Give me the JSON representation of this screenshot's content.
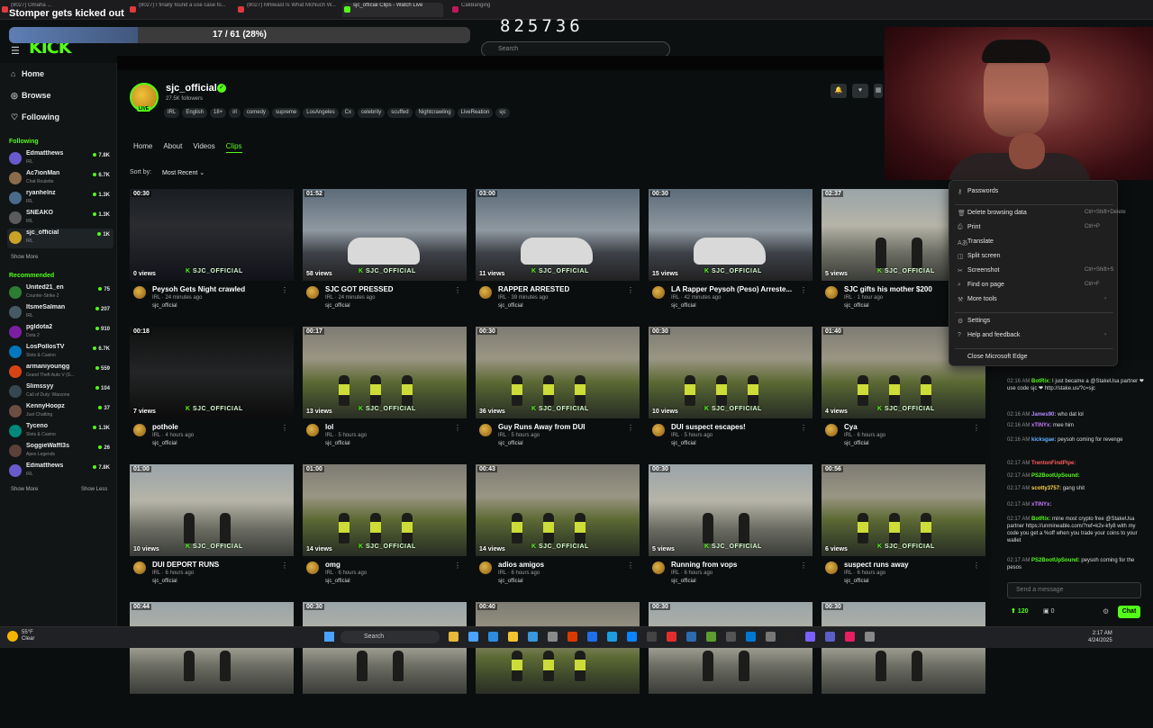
{
  "browser": {
    "tabs": [
      {
        "label": "(8027) Omaha ..."
      },
      {
        "label": "(8027) I finally found a use case fo..."
      },
      {
        "label": "(8027) MrBeast Is What McNuch W..."
      },
      {
        "label": "sjc_official Clips - Watch Live"
      },
      {
        "label": "CaliBanging"
      }
    ]
  },
  "overlay": {
    "stream_title": "Stomper gets kicked out",
    "progress_text": "17 / 61 (28%)",
    "progress_fraction": 0.28,
    "counter": "825736"
  },
  "site": {
    "logo": "KICK",
    "search_placeholder": "Search"
  },
  "sidebar": {
    "nav": [
      {
        "label": "Home",
        "icon": "home-icon"
      },
      {
        "label": "Browse",
        "icon": "compass-icon"
      },
      {
        "label": "Following",
        "icon": "heart-icon"
      }
    ],
    "following_title": "Following",
    "following": [
      {
        "name": "Edmatthews",
        "category": "IRL",
        "viewers": "7.8K"
      },
      {
        "name": "Ac7ionMan",
        "category": "Chat Roulette",
        "viewers": "6.7K"
      },
      {
        "name": "ryanhelnz",
        "category": "IRL",
        "viewers": "1.3K"
      },
      {
        "name": "SNEAKO",
        "category": "IRL",
        "viewers": "1.3K"
      },
      {
        "name": "sjc_official",
        "category": "IRL",
        "viewers": "1K"
      }
    ],
    "show_more": "Show More",
    "recommended_title": "Recommended",
    "recommended": [
      {
        "name": "United21_en",
        "category": "Counter-Strike 2",
        "viewers": "75"
      },
      {
        "name": "ItsmeSalman",
        "category": "IRL",
        "viewers": "207"
      },
      {
        "name": "pgldota2",
        "category": "Dota 2",
        "viewers": "910"
      },
      {
        "name": "LosPollosTV",
        "category": "Slots & Casino",
        "viewers": "6.7K"
      },
      {
        "name": "armaniyoungg",
        "category": "Grand Theft Auto V (G...",
        "viewers": "559"
      },
      {
        "name": "Slimssyy",
        "category": "Call of Duty: Warzone",
        "viewers": "104"
      },
      {
        "name": "KennyHoopz",
        "category": "Just Chatting",
        "viewers": "37"
      },
      {
        "name": "Tyceno",
        "category": "Slots & Casino",
        "viewers": "1.3K"
      },
      {
        "name": "SoggieWaffl3s",
        "category": "Apex Legends",
        "viewers": "26"
      },
      {
        "name": "Edmatthews",
        "category": "IRL",
        "viewers": "7.8K"
      }
    ],
    "show_more_2": "Show More",
    "show_less": "Show Less"
  },
  "channel": {
    "live_badge": "LIVE",
    "name": "sjc_official",
    "followers": "27.5K followers",
    "tags": [
      "IRL",
      "English",
      "18+",
      "irl",
      "comedy",
      "supreme",
      "LosAngeles",
      "Cx",
      "celebrity",
      "scuffed",
      "Nightcrawling",
      "LiveReation",
      "sjc"
    ],
    "tabs": [
      "Home",
      "About",
      "Videos",
      "Clips"
    ],
    "active_tab": "Clips",
    "sort_label": "Sort by:",
    "sort_value": "Most Recent"
  },
  "clips": [
    {
      "duration": "00:30",
      "views": "0 views",
      "title": "Peysoh Gets Night crawled",
      "meta": "IRL · 24 minutes ago",
      "owner": "sjc_official",
      "scene": "night"
    },
    {
      "duration": "01:52",
      "views": "58 views",
      "title": "SJC GOT PRESSED",
      "meta": "IRL · 24 minutes ago",
      "owner": "sjc_official",
      "scene": "car"
    },
    {
      "duration": "03:00",
      "views": "11 views",
      "title": "RAPPER ARRESTED",
      "meta": "IRL · 39 minutes ago",
      "owner": "sjc_official",
      "scene": "car"
    },
    {
      "duration": "00:30",
      "views": "15 views",
      "title": "LA Rapper Peysoh (Peso) Arreste...",
      "meta": "IRL · 42 minutes ago",
      "owner": "sjc_official",
      "scene": "car"
    },
    {
      "duration": "02:37",
      "views": "5 views",
      "title": "SJC gifts his mother $200",
      "meta": "IRL · 1 hour ago",
      "owner": "sjc_official",
      "scene": "street"
    },
    {
      "duration": "00:18",
      "views": "7 views",
      "title": "pothole",
      "meta": "IRL · 4 hours ago",
      "owner": "sjc_official",
      "scene": "dark"
    },
    {
      "duration": "00:17",
      "views": "13 views",
      "title": "lol",
      "meta": "IRL · 5 hours ago",
      "owner": "sjc_official",
      "scene": "police"
    },
    {
      "duration": "00:30",
      "views": "36 views",
      "title": "Guy Runs Away from DUI",
      "meta": "IRL · 5 hours ago",
      "owner": "sjc_official",
      "scene": "police"
    },
    {
      "duration": "00:30",
      "views": "10 views",
      "title": "DUI suspect escapes!",
      "meta": "IRL · 5 hours ago",
      "owner": "sjc_official",
      "scene": "police"
    },
    {
      "duration": "01:40",
      "views": "4 views",
      "title": "Cya",
      "meta": "IRL · 6 hours ago",
      "owner": "sjc_official",
      "scene": "police"
    },
    {
      "duration": "01:00",
      "views": "10 views",
      "title": "DUI DEPORT RUNS",
      "meta": "IRL · 6 hours ago",
      "owner": "sjc_official",
      "scene": "street"
    },
    {
      "duration": "01:00",
      "views": "14 views",
      "title": "omg",
      "meta": "IRL · 6 hours ago",
      "owner": "sjc_official",
      "scene": "police"
    },
    {
      "duration": "00:43",
      "views": "14 views",
      "title": "adios amigos",
      "meta": "IRL · 6 hours ago",
      "owner": "sjc_official",
      "scene": "police"
    },
    {
      "duration": "00:30",
      "views": "5 views",
      "title": "Running from vops",
      "meta": "IRL · 6 hours ago",
      "owner": "sjc_official",
      "scene": "street"
    },
    {
      "duration": "00:56",
      "views": "6 views",
      "title": "suspect runs away",
      "meta": "IRL · 6 hours ago",
      "owner": "sjc_official",
      "scene": "police"
    },
    {
      "duration": "00:44",
      "scene": "street"
    },
    {
      "duration": "00:30",
      "scene": "street"
    },
    {
      "duration": "00:40",
      "scene": "police"
    },
    {
      "duration": "00:30",
      "scene": "street"
    },
    {
      "duration": "00:30",
      "scene": "street"
    }
  ],
  "watermark": "SJC_OFFICIAL",
  "context_menu": {
    "items": [
      {
        "label": "Passwords",
        "shortcut": ""
      },
      {
        "label": "Delete browsing data",
        "shortcut": "Ctrl+Shift+Delete"
      },
      {
        "label": "Print",
        "shortcut": "Ctrl+P"
      },
      {
        "label": "Translate",
        "shortcut": ""
      },
      {
        "label": "Split screen",
        "shortcut": ""
      },
      {
        "label": "Screenshot",
        "shortcut": "Ctrl+Shift+S"
      },
      {
        "label": "Find on page",
        "shortcut": "Ctrl+F"
      },
      {
        "label": "More tools",
        "shortcut": ""
      },
      {
        "label": "Settings",
        "shortcut": ""
      },
      {
        "label": "Help and feedback",
        "shortcut": ""
      },
      {
        "label": "Close Microsoft Edge",
        "shortcut": ""
      }
    ]
  },
  "chat": {
    "messages": [
      {
        "time": "02:16 AM",
        "user": "BotRix:",
        "color": "#53fc18",
        "text": "I just became a @StakeUsa partner ❤ use code sjc ❤ http://stake.us/?c=sjc"
      },
      {
        "time": "02:16 AM",
        "user": "James90:",
        "color": "#b28cff",
        "text": "who dat lol"
      },
      {
        "time": "02:16 AM",
        "user": "xTINYx:",
        "color": "#c77dff",
        "text": "mee him"
      },
      {
        "time": "02:16 AM",
        "user": "kicksgae:",
        "color": "#5fb3ff",
        "text": "peysoh coming for revenge"
      },
      {
        "time": "02:17 AM",
        "user": "TrentonFindPipe:",
        "color": "#ff5c5c",
        "text": ""
      },
      {
        "time": "02:17 AM",
        "user": "PS2BootUpSound:",
        "color": "#53fc18",
        "text": ""
      },
      {
        "time": "02:17 AM",
        "user": "scotty3757:",
        "color": "#ffd54a",
        "text": "gang shit"
      },
      {
        "time": "02:17 AM",
        "user": "xTINYx:",
        "color": "#c77dff",
        "text": ""
      },
      {
        "time": "02:17 AM",
        "user": "BotRix:",
        "color": "#53fc18",
        "text": "mine most crypto free @StakeUsa partner https://unmineable.com/?ref=k2v-kfy8 with my code you get a %off when you trade your coins to your wallet"
      },
      {
        "time": "02:17 AM",
        "user": "PS2BootUpSound:",
        "color": "#53fc18",
        "text": "peysoh coming for the pesos"
      }
    ],
    "input_placeholder": "Send a message",
    "points": "120",
    "points2": "0",
    "send_label": "Chat"
  },
  "taskbar": {
    "temp": "55°F",
    "weather": "Clear",
    "search": "Search",
    "time": "2:17 AM",
    "date": "4/24/2025"
  }
}
